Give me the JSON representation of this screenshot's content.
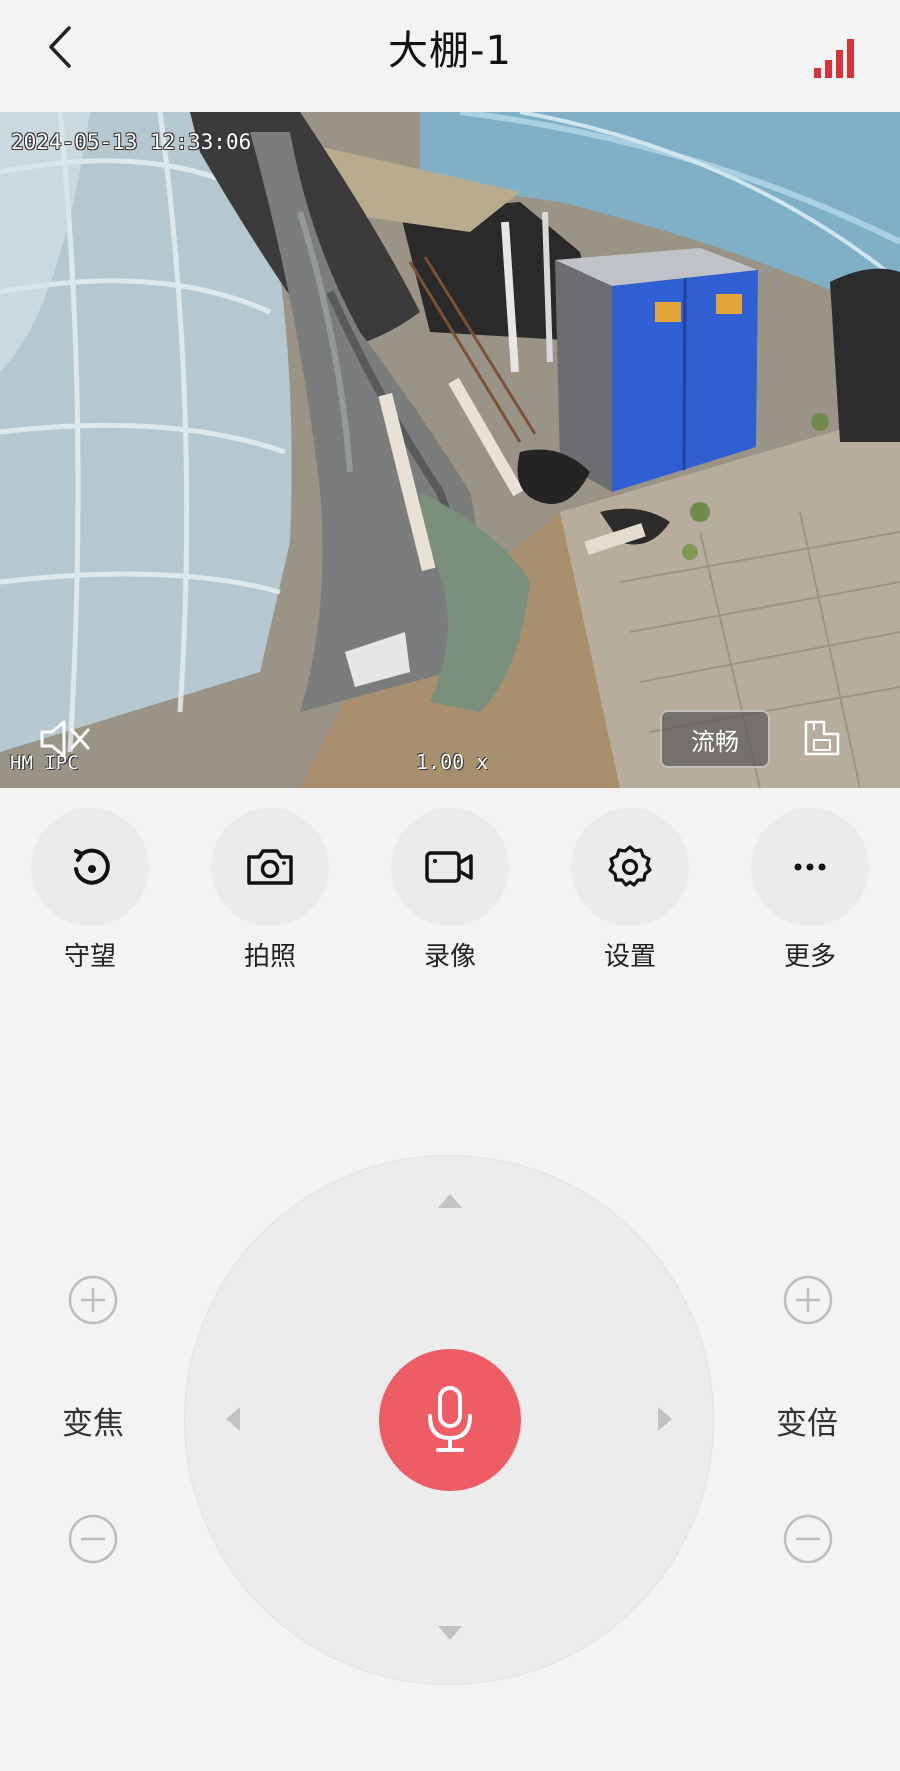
{
  "header": {
    "title": "大棚-1"
  },
  "video": {
    "timestamp": "2024-05-13 12:33:06",
    "osd_label": "HM IPC",
    "zoom_level": "1.00 x",
    "quality_label": "流畅"
  },
  "actions": [
    {
      "label": "守望",
      "icon": "watch-icon"
    },
    {
      "label": "拍照",
      "icon": "camera-icon"
    },
    {
      "label": "录像",
      "icon": "video-camera-icon"
    },
    {
      "label": "设置",
      "icon": "gear-icon"
    },
    {
      "label": "更多",
      "icon": "more-icon"
    }
  ],
  "controls": {
    "focus_label": "变焦",
    "zoom_label": "变倍"
  },
  "colors": {
    "accent": "#ee5c64",
    "signal": "#d6333b"
  }
}
